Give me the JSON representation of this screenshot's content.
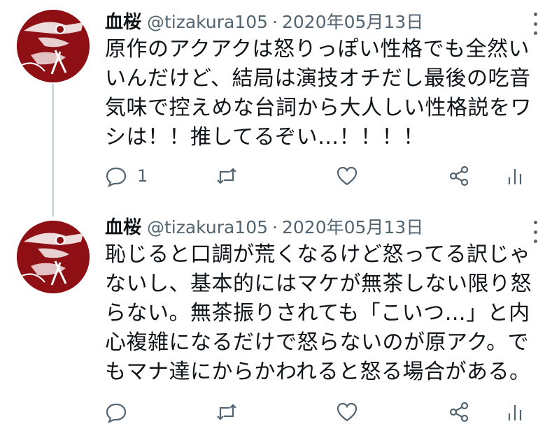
{
  "tweets": [
    {
      "name": "血桜",
      "handle": "@tizakura105",
      "separator": "·",
      "date": "2020年05月13日",
      "lines": [
        "原作のアクアクは怒りっぽい性格でも全然い",
        "いんだけど、結局は演技オチだし最後の吃音",
        "気味で控えめな台詞から大人しい性格説をワ",
        "シは！！推してるぞい…！！！！"
      ],
      "reply_count": "1",
      "icons": {
        "reply": "reply-icon",
        "retweet": "retweet-icon",
        "like": "like-icon",
        "share": "share-icon",
        "stats": "stats-icon"
      }
    },
    {
      "name": "血桜",
      "handle": "@tizakura105",
      "separator": "·",
      "date": "2020年05月13日",
      "lines": [
        "恥じると口調が荒くなるけど怒ってる訳じゃ",
        "ないし、基本的にはマケが無茶しない限り怒",
        "らない。無茶振りされても「こいつ…」と内",
        "心複雑になるだけで怒らないのが原アク。で",
        "もマナ達にからかわれると怒る場合がある。"
      ],
      "reply_count": "",
      "icons": {
        "reply": "reply-icon",
        "retweet": "retweet-icon",
        "like": "like-icon",
        "share": "share-icon",
        "stats": "stats-icon"
      }
    }
  ],
  "colors": {
    "text": "#0f1419",
    "secondary": "#536471",
    "thread_line": "#cfd9de",
    "avatar_bg": "#8e0f14"
  }
}
